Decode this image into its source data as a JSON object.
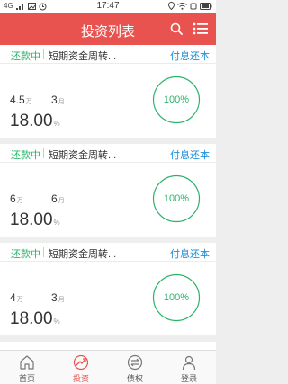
{
  "status_bar": {
    "carrier": "4G",
    "time": "17:47"
  },
  "header": {
    "title": "投资列表"
  },
  "cards": [
    {
      "status": "还款中",
      "product_name": "短期资金周转...",
      "repay_method": "付息还本",
      "amount": "4.5",
      "amount_unit": "万",
      "term": "3",
      "term_unit": "月",
      "rate": "18.00",
      "rate_unit": "%",
      "progress": "100%"
    },
    {
      "status": "还款中",
      "product_name": "短期资金周转...",
      "repay_method": "付息还本",
      "amount": "6",
      "amount_unit": "万",
      "term": "6",
      "term_unit": "月",
      "rate": "18.00",
      "rate_unit": "%",
      "progress": "100%"
    },
    {
      "status": "还款中",
      "product_name": "短期资金周转...",
      "repay_method": "付息还本",
      "amount": "4",
      "amount_unit": "万",
      "term": "3",
      "term_unit": "月",
      "rate": "18.00",
      "rate_unit": "%",
      "progress": "100%"
    }
  ],
  "bottom_nav": [
    {
      "label": "首页",
      "icon": "home-icon",
      "active": false
    },
    {
      "label": "投资",
      "icon": "invest-icon",
      "active": true
    },
    {
      "label": "债权",
      "icon": "transfer-icon",
      "active": false
    },
    {
      "label": "登录",
      "icon": "user-icon",
      "active": false
    }
  ],
  "colors": {
    "accent": "#e8534f",
    "status_green": "#2bb36b",
    "link_blue": "#1f8fd8"
  }
}
